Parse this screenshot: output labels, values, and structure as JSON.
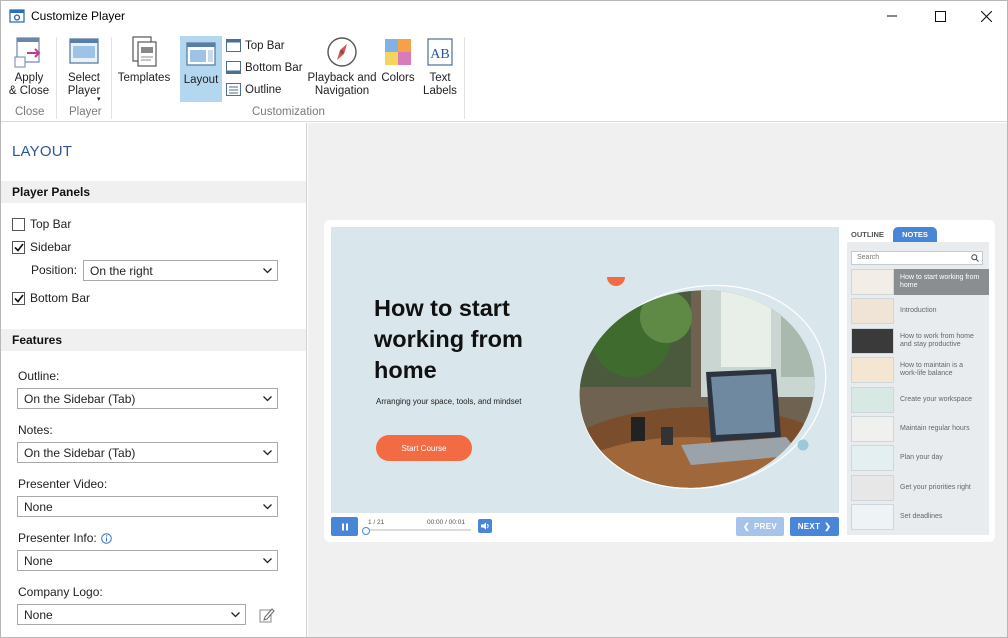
{
  "window": {
    "title": "Customize Player"
  },
  "ribbon": {
    "apply_close": "Apply\n& Close",
    "select_player": "Select\nPlayer",
    "templates": "Templates",
    "layout": "Layout",
    "top_bar": "Top Bar",
    "bottom_bar": "Bottom Bar",
    "outline": "Outline",
    "playback_navigation": "Playback and\nNavigation",
    "colors": "Colors",
    "text_labels": "Text\nLabels",
    "groups": {
      "close": "Close",
      "player": "Player",
      "customization": "Customization"
    }
  },
  "panel": {
    "title": "LAYOUT",
    "player_panels": "Player Panels",
    "top_bar": {
      "label": "Top Bar",
      "checked": false
    },
    "sidebar": {
      "label": "Sidebar",
      "checked": true
    },
    "position_label": "Position:",
    "position_value": "On the right",
    "bottom_bar": {
      "label": "Bottom Bar",
      "checked": true
    },
    "features": "Features",
    "outline_label": "Outline:",
    "outline_value": "On the Sidebar (Tab)",
    "notes_label": "Notes:",
    "notes_value": "On the Sidebar (Tab)",
    "presenter_video_label": "Presenter Video:",
    "presenter_video_value": "None",
    "presenter_info_label": "Presenter Info:",
    "presenter_info_value": "None",
    "company_logo_label": "Company Logo:",
    "company_logo_value": "None"
  },
  "preview": {
    "slide_title": "How to start working from home",
    "slide_subtitle": "Arranging your space, tools, and mindset",
    "start_button": "Start Course",
    "slide_counter": "1 / 21",
    "time": "00:00 / 00:01",
    "prev": "PREV",
    "next": "NEXT",
    "tab_outline": "OUTLINE",
    "tab_notes": "NOTES",
    "search_placeholder": "Search",
    "outline_items": [
      "How to start working from home",
      "Introduction",
      "How to work from home and stay productive",
      "How to maintain is a work-life balance",
      "Create your workspace",
      "Maintain regular hours",
      "Plan your day",
      "Get your priorities right",
      "Set deadlines"
    ]
  },
  "colors": {
    "accent": "#4a86d8",
    "title_link": "#2f5597",
    "slide_bg": "#d9e6eb",
    "orange": "#f26b43",
    "selected": "#b4d7f0"
  }
}
